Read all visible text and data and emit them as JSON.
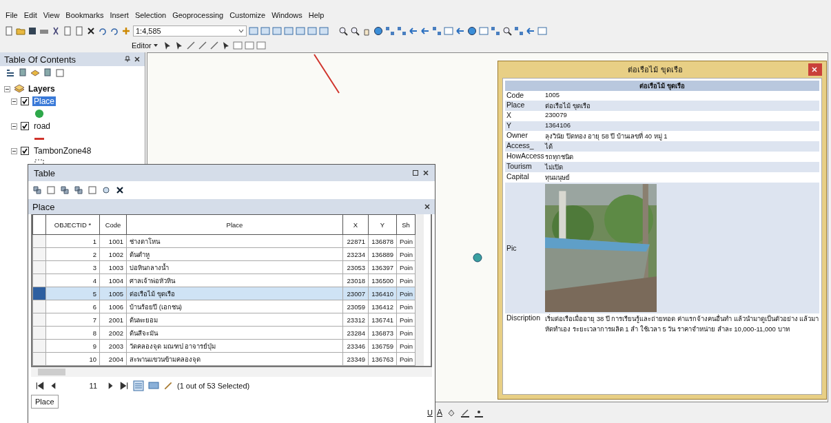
{
  "menu": [
    "File",
    "Edit",
    "View",
    "Bookmarks",
    "Insert",
    "Selection",
    "Geoprocessing",
    "Customize",
    "Windows",
    "Help"
  ],
  "toolbar": {
    "scale": "1:4,585"
  },
  "editor_toolbar": {
    "label": "Editor"
  },
  "toc": {
    "title": "Table Of Contents",
    "root": "Layers",
    "layers": [
      {
        "name": "Place",
        "checked": true,
        "selected": true,
        "kind": "point"
      },
      {
        "name": "road",
        "checked": true,
        "selected": false,
        "kind": "line"
      },
      {
        "name": "TambonZone48",
        "checked": true,
        "selected": false,
        "kind": "polygon"
      }
    ]
  },
  "table_window": {
    "title": "Table",
    "table_name": "Place",
    "columns": [
      "OBJECTID *",
      "Code",
      "Place",
      "X",
      "Y",
      "Sh"
    ],
    "rows": [
      {
        "cells": [
          "1",
          "1001",
          "ช่างตาโหน",
          "22871",
          "136878",
          "Poin"
        ],
        "selected": false
      },
      {
        "cells": [
          "2",
          "1002",
          "ต้นตำหู",
          "23234",
          "136889",
          "Poin"
        ],
        "selected": false
      },
      {
        "cells": [
          "3",
          "1003",
          "บ่อหินกลางน้ำ",
          "23053",
          "136397",
          "Poin"
        ],
        "selected": false
      },
      {
        "cells": [
          "4",
          "1004",
          "ศาลเจ้าพ่อหัวหิน",
          "23018",
          "136500",
          "Poin"
        ],
        "selected": false
      },
      {
        "cells": [
          "5",
          "1005",
          "ต่อเรือไม้ ขุดเรือ",
          "23007",
          "136410",
          "Poin"
        ],
        "selected": true
      },
      {
        "cells": [
          "6",
          "1006",
          "บ้านร้อยปี (เอกชน)",
          "23059",
          "136412",
          "Poin"
        ],
        "selected": false
      },
      {
        "cells": [
          "7",
          "2001",
          "ต้นพะยอม",
          "23312",
          "136741",
          "Poin"
        ],
        "selected": false
      },
      {
        "cells": [
          "8",
          "2002",
          "ต้นสีจะมัน",
          "23284",
          "136873",
          "Poin"
        ],
        "selected": false
      },
      {
        "cells": [
          "9",
          "2003",
          "วัดคลองจุด มณฑป อาจารย์ปุ่ม",
          "23346",
          "136759",
          "Poin"
        ],
        "selected": false
      },
      {
        "cells": [
          "10",
          "2004",
          "สะพานแขวนข้ามคลองจุด",
          "23349",
          "136763",
          "Poin"
        ],
        "selected": false
      }
    ],
    "record": "11",
    "selection_status": "(1 out of 53 Selected)",
    "tab": "Place"
  },
  "popup": {
    "title": "ต่อเรือไม้ ขุดเรือ",
    "header": "ต่อเรือไม้ ขุดเรือ",
    "fields": [
      {
        "name": "Code",
        "value": "1005"
      },
      {
        "name": "Place",
        "value": "ต่อเรือไม้ ขุดเรือ"
      },
      {
        "name": "X",
        "value": "230079"
      },
      {
        "name": "Y",
        "value": "1364106"
      },
      {
        "name": "Owner",
        "value": "ลุงวินัย ปิดทอง อายุ 58 ปี บ้านเลขที่ 40 หมู่ 1"
      },
      {
        "name": "Access_",
        "value": "ได้"
      },
      {
        "name": "HowAccess",
        "value": "รถทุกชนิด"
      },
      {
        "name": "Tourism",
        "value": "ไม่เปิด"
      },
      {
        "name": "Capital",
        "value": "ทุนมนุษย์"
      },
      {
        "name": "Pic",
        "kind": "picture"
      },
      {
        "name": "Discription",
        "value": "เริ่มต่อเรือเมื่ออายุ 38 ปี การเรียนรู้และถ่ายทอด ค่าแรกจ้างคนอื่นทำ แล้วนำมาดูเป็นตัวอย่าง แล้วมาหัดทำเอง ระยะเวลาการผลิต 1 ลำ ใช้เวลา 5 วัน ราคาจำหน่าย ลำละ 10,000-11,000 บาท"
      }
    ]
  },
  "format_toolbar": {
    "underline": "U",
    "font_color": "A"
  }
}
